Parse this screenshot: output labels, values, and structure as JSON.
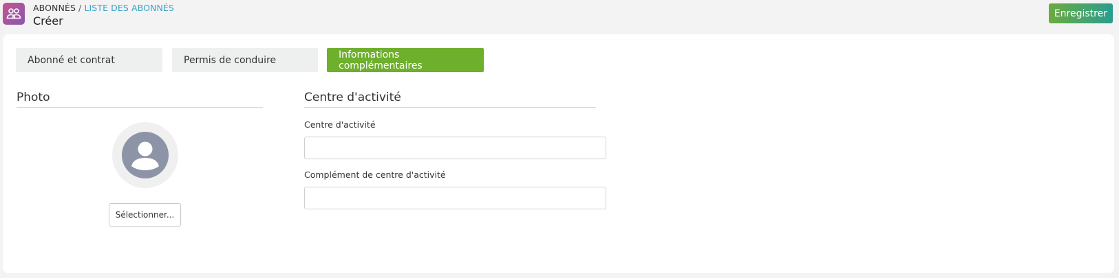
{
  "header": {
    "breadcrumb_root": "ABONNÉS",
    "breadcrumb_sep": " / ",
    "breadcrumb_link": "LISTE DES ABONNÉS",
    "title": "Créer",
    "save_label": "Enregistrer"
  },
  "tabs": [
    {
      "label": "Abonné et contrat",
      "active": false
    },
    {
      "label": "Permis de conduire",
      "active": false
    },
    {
      "label": "Informations complémentaires",
      "active": true
    }
  ],
  "photo": {
    "section_title": "Photo",
    "select_label": "Sélectionner..."
  },
  "activity": {
    "section_title": "Centre d'activité",
    "field1_label": "Centre d'activité",
    "field1_value": "",
    "field2_label": "Complément de centre d'activité",
    "field2_value": ""
  },
  "colors": {
    "accent_green": "#6eaf2c",
    "link_blue": "#3aa3c9",
    "app_icon": "#a8559f"
  },
  "icons": {
    "app": "users-icon",
    "avatar": "user-avatar-icon"
  }
}
